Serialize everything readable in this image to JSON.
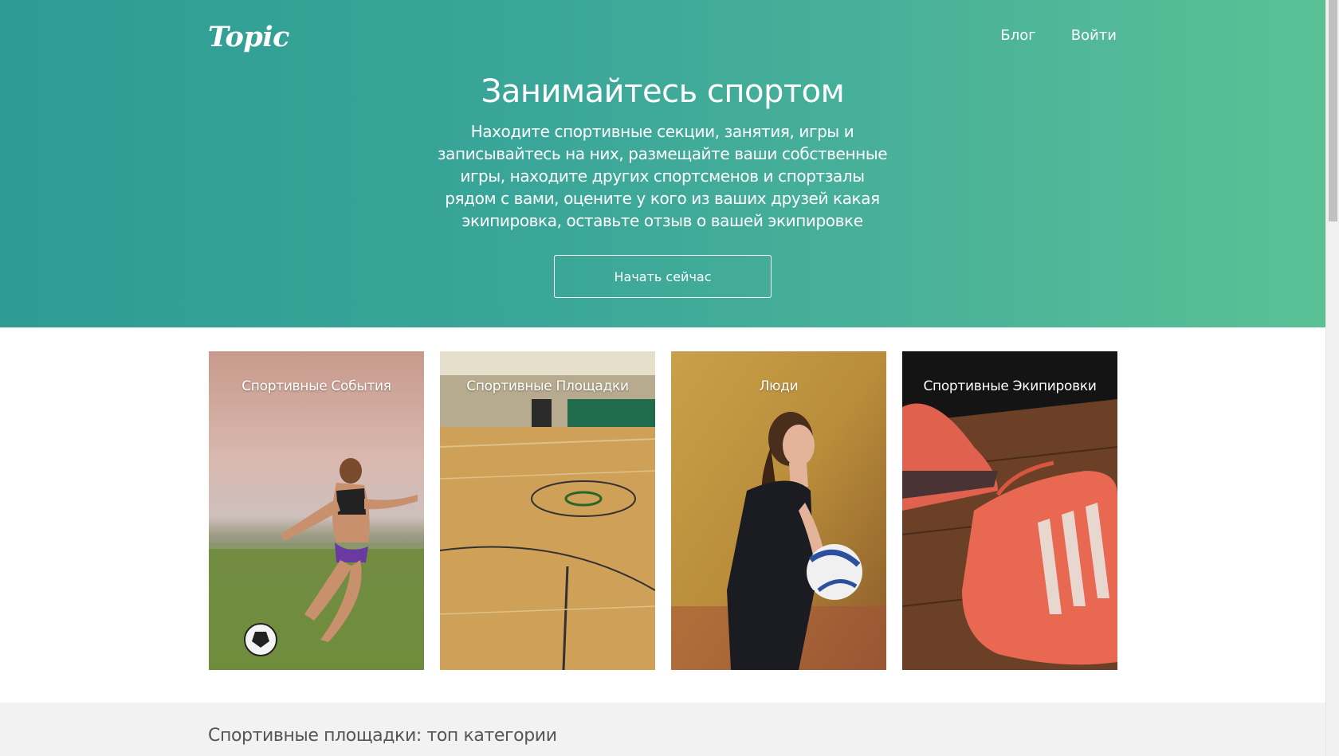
{
  "header": {
    "logo": "Topic",
    "nav": [
      "Блог",
      "Войти"
    ]
  },
  "hero": {
    "title": "Занимайтесь спортом",
    "description": "Находите спортивные секции, занятия, игры и записывайтесь на них, размещайте ваши собственные игры, находите других спортсменов и спортзалы рядом с вами, оцените у кого из ваших друзей какая экипировка, оставьте отзыв о вашей экипировке",
    "cta_label": "Начать сейчас"
  },
  "cards": [
    {
      "label": "Спортивные События",
      "image": "soccer-player-photo"
    },
    {
      "label": "Спортивные Площадки",
      "image": "gym-court-photo"
    },
    {
      "label": "Люди",
      "image": "volleyball-player-photo"
    },
    {
      "label": "Спортивные Экипировки",
      "image": "sneakers-photo"
    }
  ],
  "section": {
    "title": "Спортивные площадки: топ категории"
  },
  "colors": {
    "hero_start": "#2e9c93",
    "hero_end": "#5ac195",
    "section_bg": "#f2f2f2"
  }
}
